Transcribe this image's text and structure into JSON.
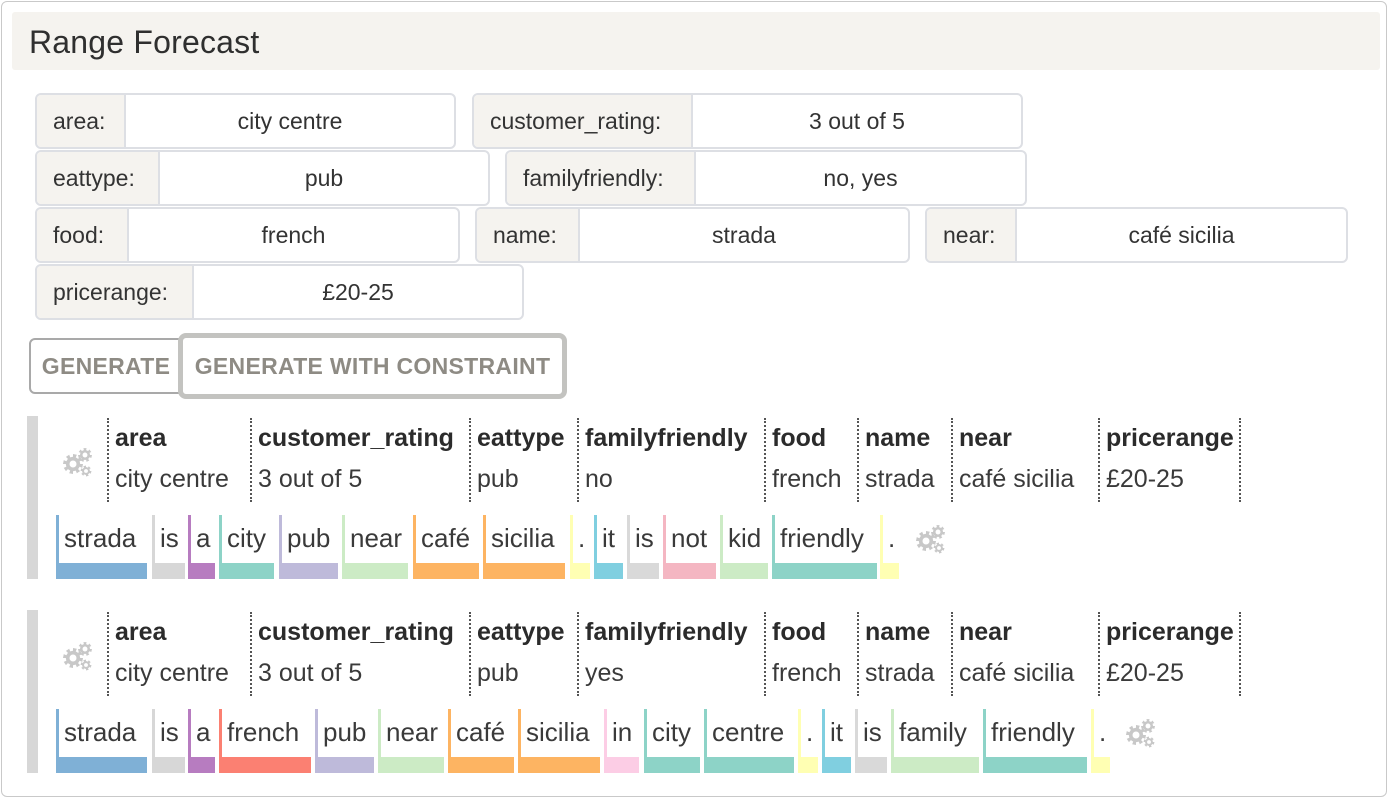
{
  "title": "Range Forecast",
  "fields": [
    {
      "label": "area:",
      "value": "city centre"
    },
    {
      "label": "customer_rating:",
      "value": "3 out of 5"
    },
    {
      "label": "eattype:",
      "value": "pub"
    },
    {
      "label": "familyfriendly:",
      "value": "no, yes"
    },
    {
      "label": "food:",
      "value": "french"
    },
    {
      "label": "name:",
      "value": "strada"
    },
    {
      "label": "near:",
      "value": "café sicilia"
    },
    {
      "label": "pricerange:",
      "value": "£20-25"
    }
  ],
  "buttons": {
    "generate": "GENERATE",
    "generate_with_constraint": "GENERATE WITH CONSTRAINT"
  },
  "results": [
    {
      "mr": [
        {
          "key": "area",
          "value": "city centre"
        },
        {
          "key": "customer_rating",
          "value": "3 out of 5"
        },
        {
          "key": "eattype",
          "value": "pub"
        },
        {
          "key": "familyfriendly",
          "value": "no"
        },
        {
          "key": "food",
          "value": "french"
        },
        {
          "key": "name",
          "value": "strada"
        },
        {
          "key": "near",
          "value": "café sicilia"
        },
        {
          "key": "pricerange",
          "value": "£20-25"
        }
      ],
      "tokens": [
        {
          "text": "strada",
          "color": "#7fb0d6"
        },
        {
          "text": "is",
          "color": "#d7d7d7"
        },
        {
          "text": "a",
          "color": "#b77cc0"
        },
        {
          "text": "city",
          "color": "#8dd3c7"
        },
        {
          "text": "pub",
          "color": "#bebada"
        },
        {
          "text": "near",
          "color": "#ccebc5"
        },
        {
          "text": "café",
          "color": "#fdb462"
        },
        {
          "text": "sicilia",
          "color": "#fdb462"
        },
        {
          "text": ".",
          "color": "#ffffb3"
        },
        {
          "text": "it",
          "color": "#80cfe0"
        },
        {
          "text": "is",
          "color": "#d9d9d9"
        },
        {
          "text": "not",
          "color": "#f4b6c2"
        },
        {
          "text": "kid",
          "color": "#ccebc5"
        },
        {
          "text": "friendly",
          "color": "#8dd3c7"
        },
        {
          "text": ".",
          "color": "#ffffb3"
        }
      ]
    },
    {
      "mr": [
        {
          "key": "area",
          "value": "city centre"
        },
        {
          "key": "customer_rating",
          "value": "3 out of 5"
        },
        {
          "key": "eattype",
          "value": "pub"
        },
        {
          "key": "familyfriendly",
          "value": "yes"
        },
        {
          "key": "food",
          "value": "french"
        },
        {
          "key": "name",
          "value": "strada"
        },
        {
          "key": "near",
          "value": "café sicilia"
        },
        {
          "key": "pricerange",
          "value": "£20-25"
        }
      ],
      "tokens": [
        {
          "text": "strada",
          "color": "#7fb0d6"
        },
        {
          "text": "is",
          "color": "#d7d7d7"
        },
        {
          "text": "a",
          "color": "#b77cc0"
        },
        {
          "text": "french",
          "color": "#fb8072"
        },
        {
          "text": "pub",
          "color": "#bebada"
        },
        {
          "text": "near",
          "color": "#ccebc5"
        },
        {
          "text": "café",
          "color": "#fdb462"
        },
        {
          "text": "sicilia",
          "color": "#fdb462"
        },
        {
          "text": "in",
          "color": "#fccde5"
        },
        {
          "text": "city",
          "color": "#8dd3c7"
        },
        {
          "text": "centre",
          "color": "#8dd3c7"
        },
        {
          "text": ".",
          "color": "#ffffb3"
        },
        {
          "text": "it",
          "color": "#80cfe0"
        },
        {
          "text": "is",
          "color": "#d9d9d9"
        },
        {
          "text": "family",
          "color": "#ccebc5"
        },
        {
          "text": "friendly",
          "color": "#8dd3c7"
        },
        {
          "text": ".",
          "color": "#ffffb3"
        }
      ]
    }
  ],
  "icons": {
    "gear": "settings-gears-icon"
  }
}
